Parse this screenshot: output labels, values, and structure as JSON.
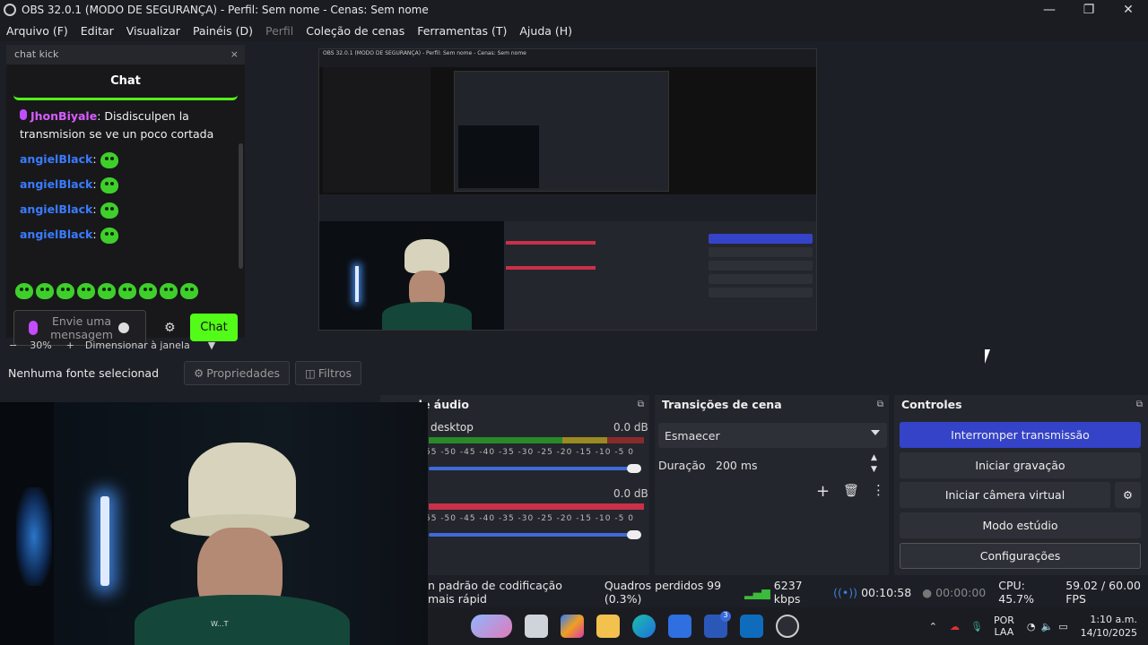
{
  "window": {
    "title": "OBS 32.0.1 (MODO DE SEGURANÇA) - Perfil: Sem nome - Cenas: Sem nome"
  },
  "menu": [
    "Arquivo (F)",
    "Editar",
    "Visualizar",
    "Painéis (D)",
    "Perfil",
    "Coleção de cenas",
    "Ferramentas (T)",
    "Ajuda (H)"
  ],
  "chat_dock": {
    "title": "chat kick",
    "header": "Chat",
    "messages": [
      {
        "user": "JhonBiyale",
        "text": ": Disdisculpen la transmision se ve un poco cortada"
      },
      {
        "user": "angielBlack",
        "text": ":"
      },
      {
        "user": "angielBlack",
        "text": ":"
      },
      {
        "user": "angielBlack",
        "text": ":"
      },
      {
        "user": "angielBlack",
        "text": ":"
      }
    ],
    "input_placeholder": "Envie uma mensagem",
    "send_label": "Chat"
  },
  "zoom": {
    "minus": "−",
    "value": "30%",
    "plus": "+",
    "fit_label": "Dimensionar à janela"
  },
  "source_bar": {
    "no_source": "Nenhuma fonte selecionad",
    "properties": "Propriedades",
    "filters": "Filtros"
  },
  "audio_mixer": {
    "title": "de áudio",
    "tracks": [
      {
        "name": "desktop",
        "db": "0.0 dB"
      },
      {
        "name": "",
        "db": "0.0 dB"
      }
    ],
    "scale": "55 -50 -45 -40 -35 -30 -25 -20 -15 -10 -5 0"
  },
  "transitions": {
    "title": "Transições de cena",
    "selected": "Esmaecer",
    "duration_label": "Duração",
    "duration_value": "200 ms"
  },
  "controls": {
    "title": "Controles",
    "stop_stream": "Interromper transmissão",
    "start_recording": "Iniciar gravação",
    "start_virtual_cam": "Iniciar câmera virtual",
    "studio_mode": "Modo estúdio",
    "settings": "Configurações"
  },
  "status": {
    "encoding": "n padrão de codificação mais rápid",
    "dropped": "Quadros perdidos 99 (0.3%)",
    "bitrate": "6237 kbps",
    "stream_time": "00:10:58",
    "rec_time": "00:00:00",
    "cpu": "CPU: 45.7%",
    "fps": "59.02 / 60.00 FPS"
  },
  "taskbar": {
    "lang1": "POR",
    "lang2": "LAA",
    "time": "1:10 a.m.",
    "date": "14/10/2025",
    "badge": "3"
  },
  "webcam": {
    "shirt_text": "W...T"
  },
  "colors": {
    "accent_blue": "#3543c9",
    "kick_green": "#53fc18",
    "bg": "#1d1f26"
  }
}
